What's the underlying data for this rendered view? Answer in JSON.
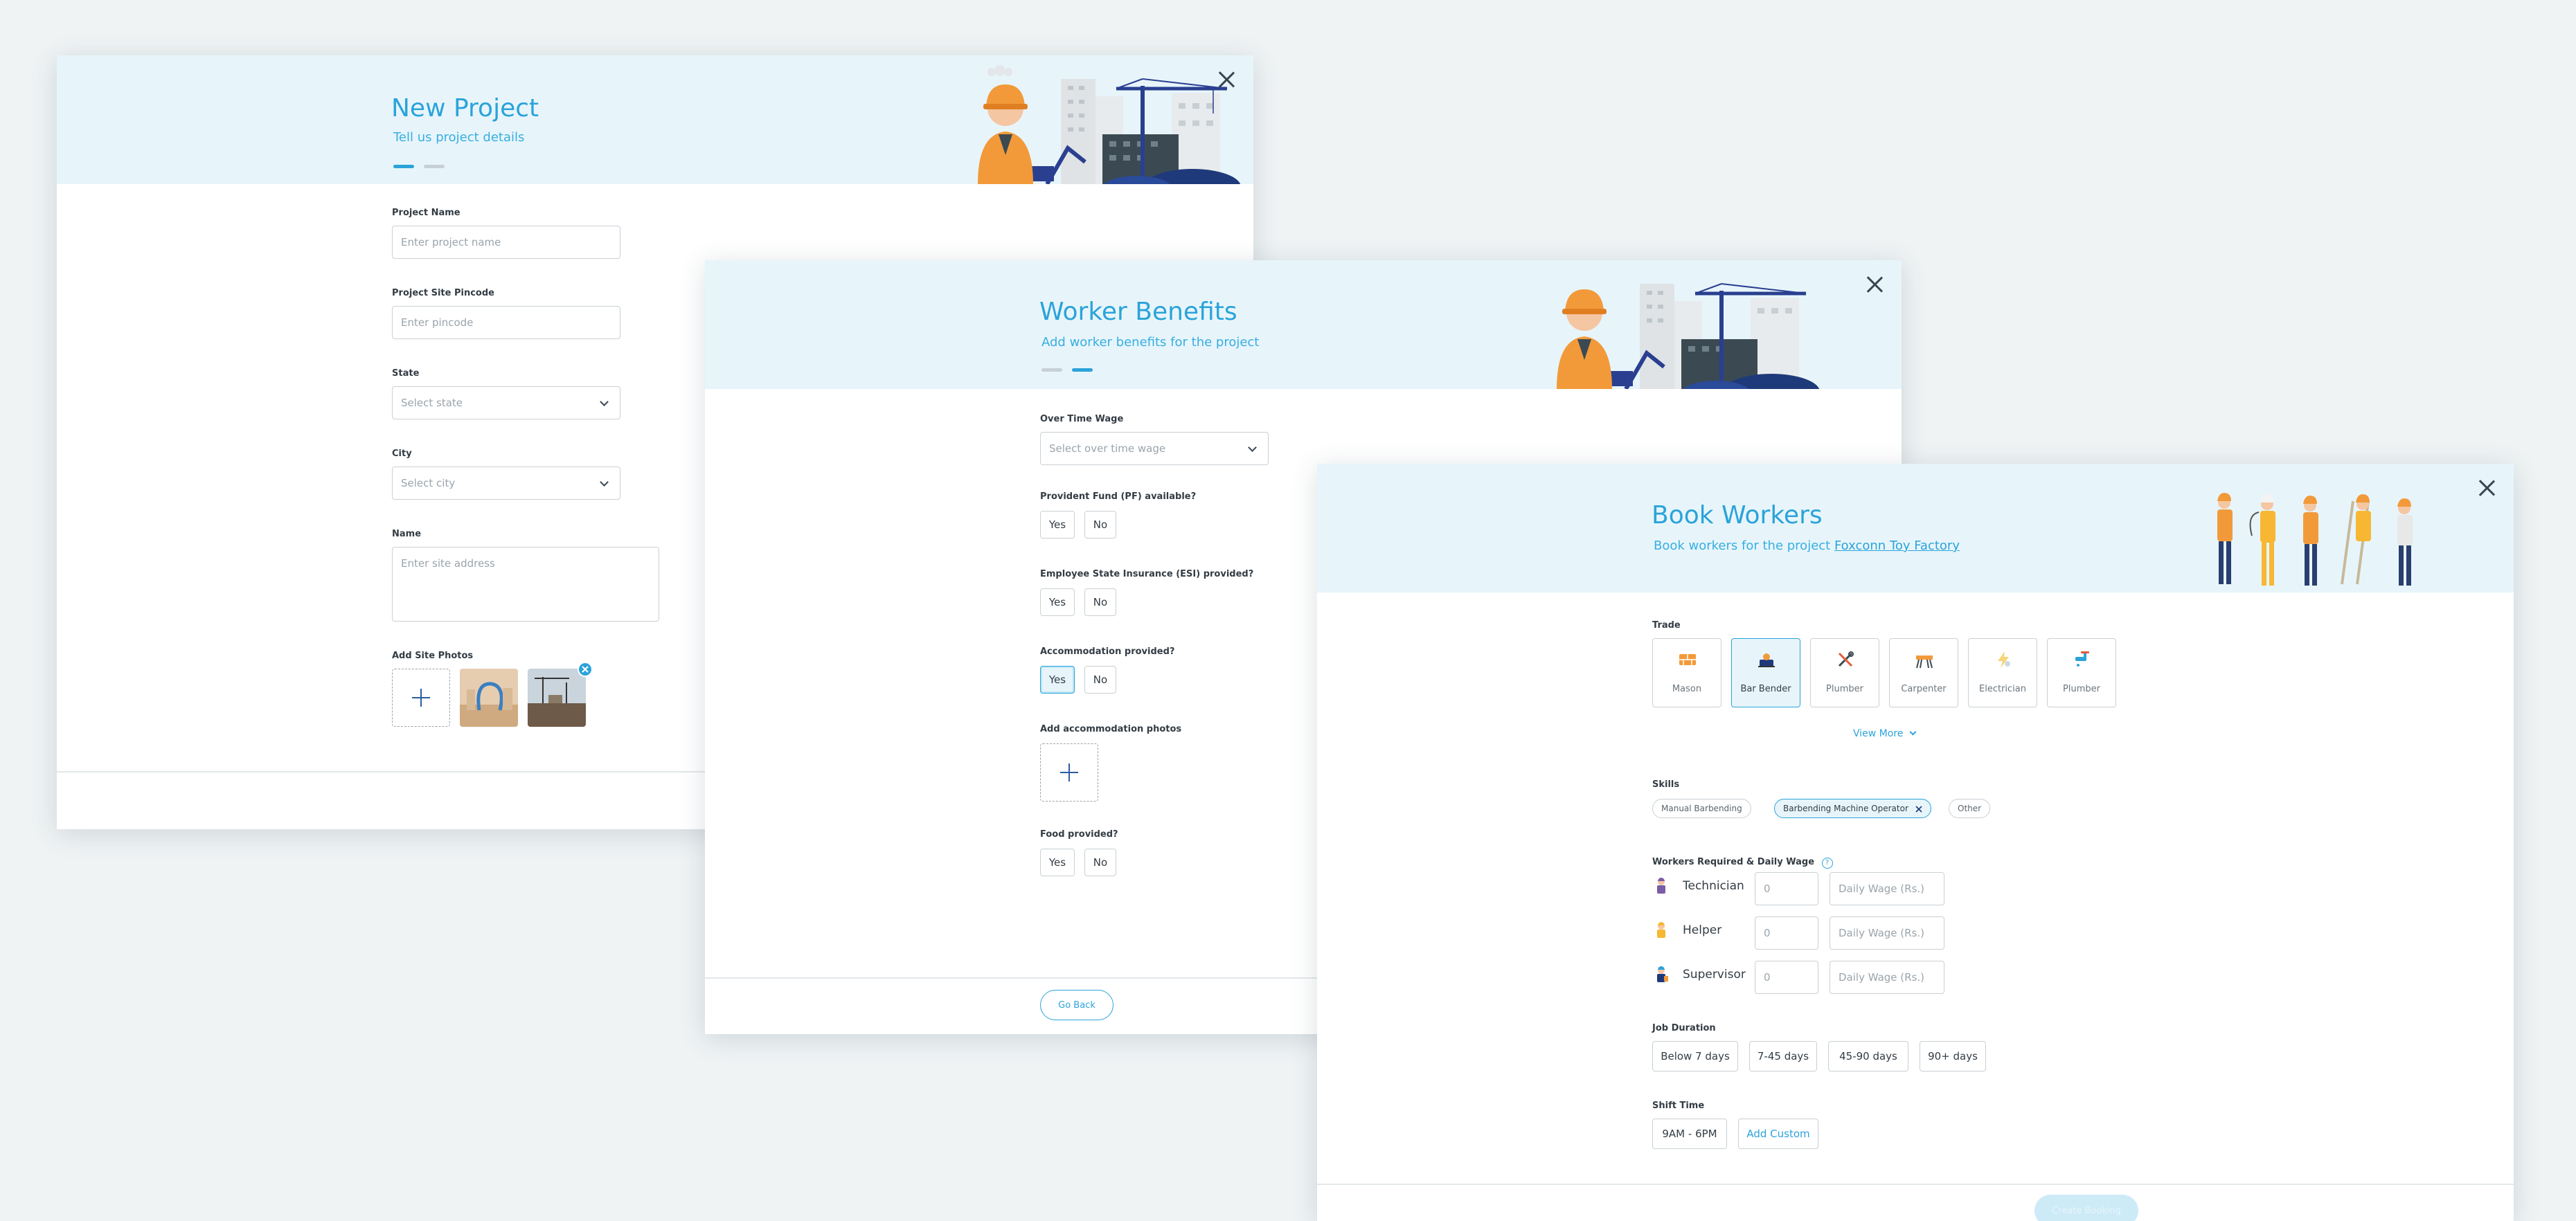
{
  "new_project": {
    "title": "New Project",
    "subtitle": "Tell us project details",
    "fields": {
      "project_name_label": "Project Name",
      "project_name_placeholder": "Enter project name",
      "pincode_label": "Project Site Pincode",
      "pincode_placeholder": "Enter pincode",
      "state_label": "State",
      "state_value": "Select state",
      "city_label": "City",
      "city_value": "Select city",
      "name_label": "Name",
      "name_placeholder": "Enter site address",
      "photos_label": "Add Site Photos"
    }
  },
  "worker_benefits": {
    "title": "Worker Benefits",
    "subtitle": "Add worker benefits for the project",
    "overtime_label": "Over Time Wage",
    "overtime_value": "Select over time wage",
    "pf_label": "Provident Fund (PF) available?",
    "esi_label": "Employee State Insurance (ESI) provided?",
    "accommodation_label": "Accommodation provided?",
    "accommodation_photos_label": "Add accommodation photos",
    "food_label": "Food provided?",
    "yes": "Yes",
    "no": "No",
    "go_back": "Go Back"
  },
  "book_workers": {
    "title": "Book Workers",
    "subtitle_prefix": "Book workers for the project",
    "project_link": "Foxconn Toy Factory",
    "trade_label": "Trade",
    "trades": [
      "Mason",
      "Bar Bender",
      "Plumber",
      "Carpenter",
      "Electrician",
      "Plumber"
    ],
    "selected_trade": "Bar Bender",
    "view_more": "View More",
    "skills_label": "Skills",
    "skills": [
      "Manual Barbending",
      "Barbending Machine Operator",
      "Other"
    ],
    "selected_skill": "Barbending Machine Operator",
    "workers_label": "Workers Required & Daily Wage",
    "roles": [
      "Technician",
      "Helper",
      "Supervisor"
    ],
    "count_placeholder": "0",
    "wage_placeholder": "Daily Wage  (Rs.)",
    "duration_label": "Job Duration",
    "durations": [
      "Below 7 days",
      "7-45 days",
      "45-90 days",
      "90+ days"
    ],
    "shift_label": "Shift Time",
    "shift_value": "9AM - 6PM",
    "add_custom": "Add Custom",
    "confirm": "Create Booking"
  },
  "colors": {
    "accent": "#2ba3d9",
    "header_bg": "#e7f5fb",
    "page_bg": "#eff3f4",
    "dark_navy": "#1f3a7a",
    "orange": "#f29a3a"
  }
}
